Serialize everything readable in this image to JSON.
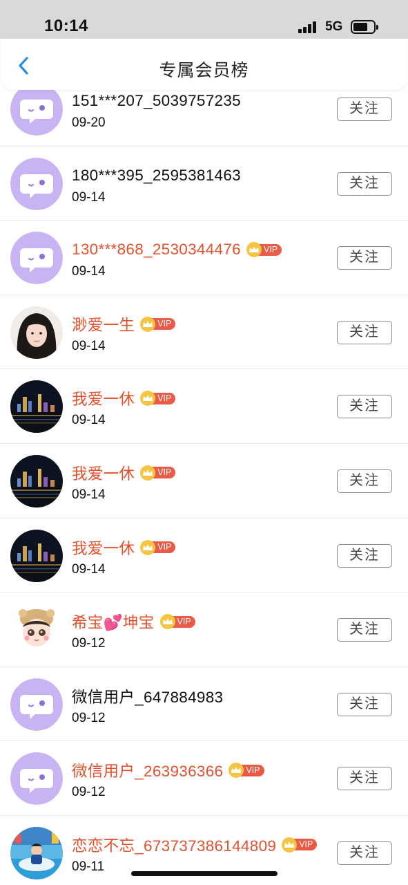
{
  "status": {
    "time": "10:14",
    "network": "5G"
  },
  "nav": {
    "title": "专属会员榜",
    "back_icon": "chevron-left-icon"
  },
  "colors": {
    "vip_name": "#e2522f",
    "vip_badge": "#ea5a46",
    "crown": "#f4c542",
    "default_avatar": "#c9b4f3"
  },
  "follow_label": "关注",
  "vip_label": "VIP",
  "members": [
    {
      "name": "151***207_5039757235",
      "date": "09-20",
      "vip": false,
      "avatar": "default"
    },
    {
      "name": "180***395_2595381463",
      "date": "09-14",
      "vip": false,
      "avatar": "default"
    },
    {
      "name": "130***868_2530344476",
      "date": "09-14",
      "vip": true,
      "avatar": "default"
    },
    {
      "name": "渺爱一生",
      "date": "09-14",
      "vip": true,
      "avatar": "portrait"
    },
    {
      "name": "我爱一休",
      "date": "09-14",
      "vip": true,
      "avatar": "night-city"
    },
    {
      "name": "我爱一休",
      "date": "09-14",
      "vip": true,
      "avatar": "night-city"
    },
    {
      "name": "我爱一休",
      "date": "09-14",
      "vip": true,
      "avatar": "night-city"
    },
    {
      "name": "希宝💕坤宝",
      "date": "09-12",
      "vip": true,
      "avatar": "cartoon-girl"
    },
    {
      "name": "微信用户_647884983",
      "date": "09-12",
      "vip": false,
      "avatar": "default"
    },
    {
      "name": "微信用户_263936366",
      "date": "09-12",
      "vip": true,
      "avatar": "default"
    },
    {
      "name": "恋恋不忘_67373738614480​9",
      "date": "09-11",
      "vip": true,
      "avatar": "playground-child"
    }
  ]
}
